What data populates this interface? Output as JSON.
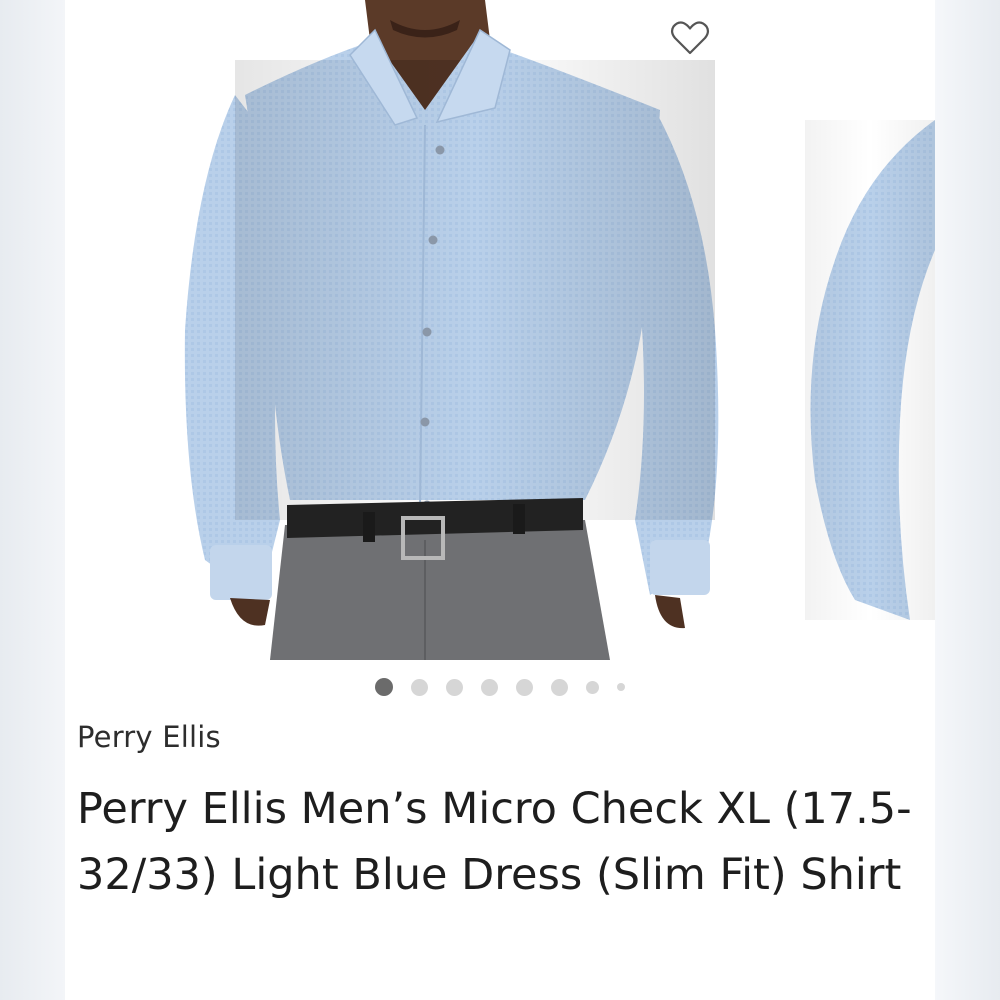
{
  "listing": {
    "brand": "Perry Ellis",
    "title": "Perry Ellis Men’s Micro Check XL (17.5-32/33) Light Blue Dress (Slim Fit) Shirt"
  },
  "carousel": {
    "image_count": 8,
    "active_index": 0,
    "favorite_icon": "heart-outline-icon"
  },
  "colors": {
    "shirt": "#b7cfe9",
    "belt": "#222222",
    "trousers": "#6f7073",
    "skin": "#5b3a28",
    "active_dot": "#6b6b6b",
    "inactive_dot": "#d6d6d6"
  }
}
